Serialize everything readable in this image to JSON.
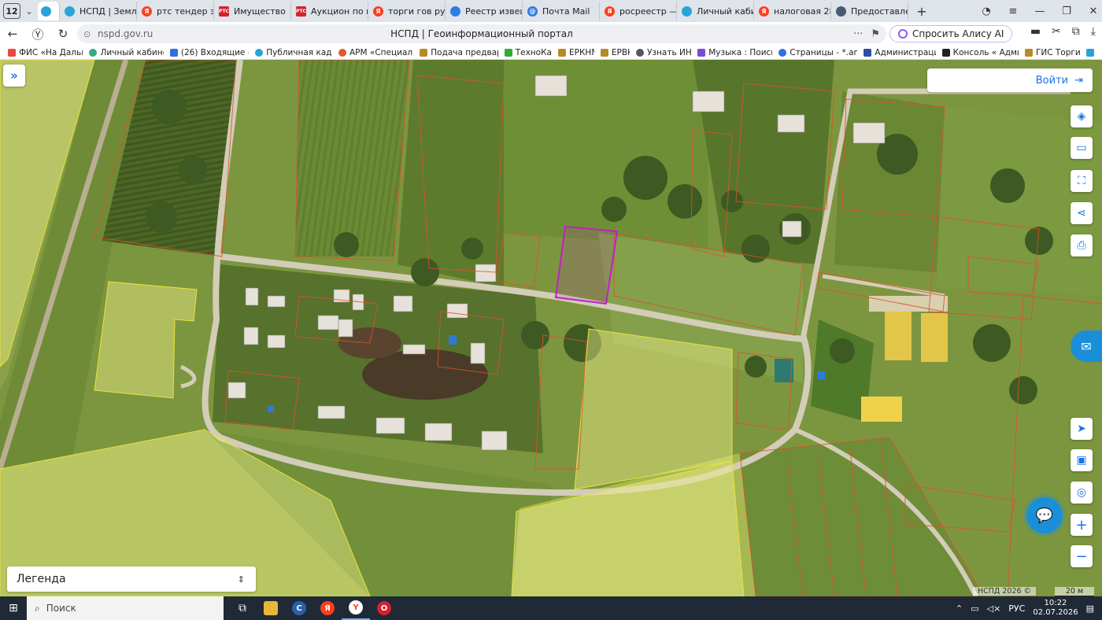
{
  "browser": {
    "tab_count": "12",
    "tabs": [
      {
        "label": "НСПД | Земля",
        "icon": "nspd-icon"
      },
      {
        "label": "ртс тендер эле",
        "icon": "yandex-icon"
      },
      {
        "label": "Имущество",
        "icon": "rts-icon"
      },
      {
        "label": "Аукцион по пр",
        "icon": "rts-icon"
      },
      {
        "label": "торги гов ру оф",
        "icon": "yandex-icon"
      },
      {
        "label": "Реестр извеще",
        "icon": "gov-icon"
      },
      {
        "label": "Почта Mail",
        "icon": "mail-icon"
      },
      {
        "label": "росреестр — Я",
        "icon": "yandex-icon"
      },
      {
        "label": "Личный кабин",
        "icon": "nalog-icon"
      },
      {
        "label": "налоговая 28 о",
        "icon": "yandex-icon"
      },
      {
        "label": "Предоставлени",
        "icon": "globe-icon"
      }
    ],
    "url": "nspd.gov.ru",
    "page_title": "НСПД | Геоинформационный портал",
    "alice_label": "Спросить Алису AI",
    "bookmarks": [
      "ФИС «На Дальни",
      "Личный кабинет",
      "(26) Входящие - Г",
      "Публичная кадас",
      "АРМ «Специалис",
      "Подача предвари",
      "ТехноКад",
      "ЕРКНМ",
      "ЕРВК",
      "Узнать ИНН",
      "Музыка : Поиск -",
      "Страницы - *.amu",
      "Администрация",
      "Консоль « Админ",
      "ГИС Торги -"
    ]
  },
  "map": {
    "login_label": "Войти",
    "legend_label": "Легенда",
    "copyright": "НСПД 2026 ©",
    "scale_label": "20 м",
    "tools": [
      "layers-icon",
      "ruler-icon",
      "select-area-icon",
      "share-icon",
      "print-icon"
    ],
    "nav_tools": [
      "locate-icon",
      "basemap-icon",
      "geolocation-icon",
      "zoom-in-icon",
      "zoom-out-icon"
    ],
    "colors": {
      "selected_parcel": "#c020c0",
      "parcel_border": "#e0502a",
      "highlight_zone": "#f0f08a"
    }
  },
  "taskbar": {
    "search_placeholder": "Поиск",
    "language": "РУС",
    "time": "10:22",
    "date": "02.07.2026"
  }
}
